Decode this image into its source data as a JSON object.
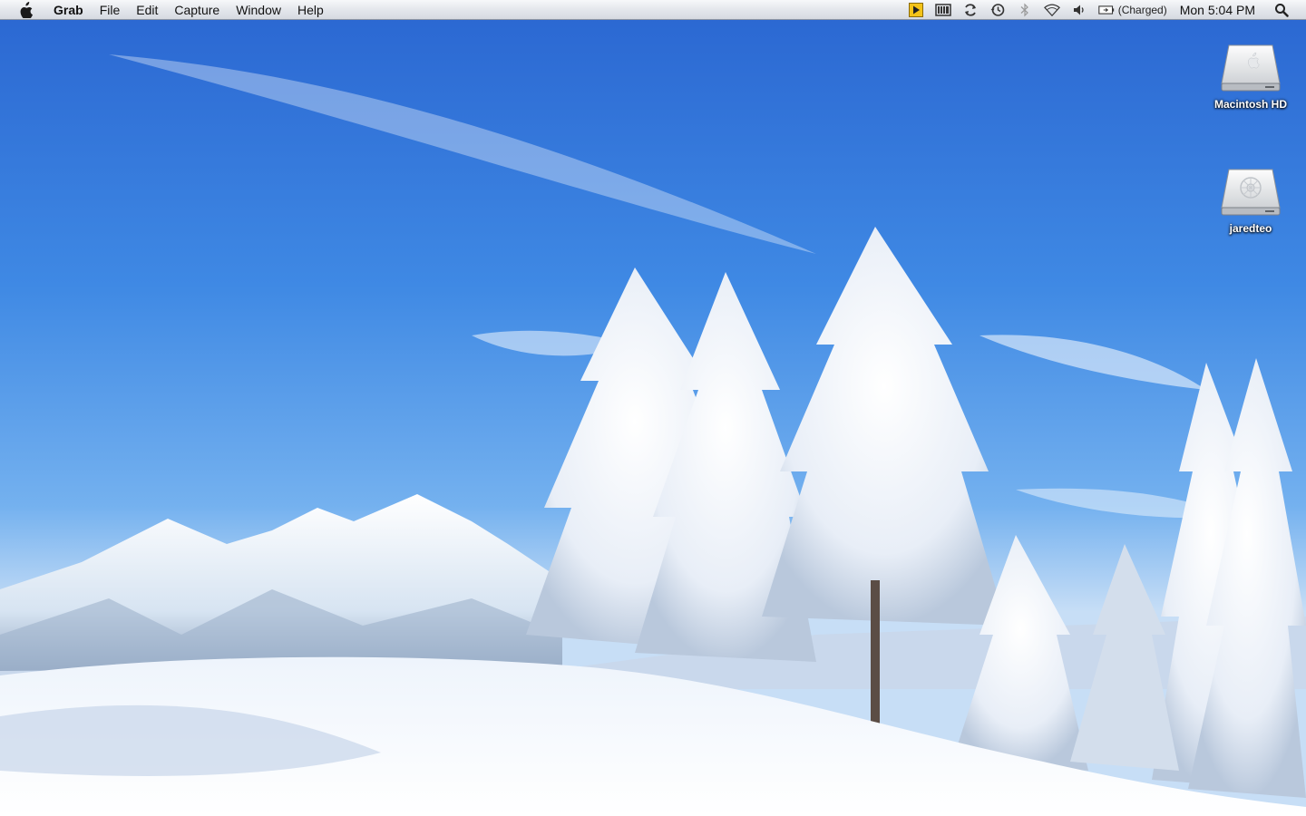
{
  "menubar": {
    "app_name": "Grab",
    "menus": [
      "File",
      "Edit",
      "Capture",
      "Window",
      "Help"
    ],
    "status_icons": [
      "media-play-icon",
      "screen-icon",
      "sync-icon",
      "time-machine-icon",
      "bluetooth-icon",
      "wifi-icon",
      "volume-icon",
      "battery-icon"
    ],
    "battery_status": "(Charged)",
    "clock": "Mon 5:04 PM"
  },
  "desktop_icons": [
    {
      "label": "Macintosh HD",
      "icon": "hard-drive-icon"
    },
    {
      "label": "jaredteo",
      "icon": "network-drive-icon"
    }
  ],
  "colors": {
    "sky_top": "#2f6fd6",
    "sky_mid": "#5aa0ee",
    "snow": "#ffffff"
  }
}
